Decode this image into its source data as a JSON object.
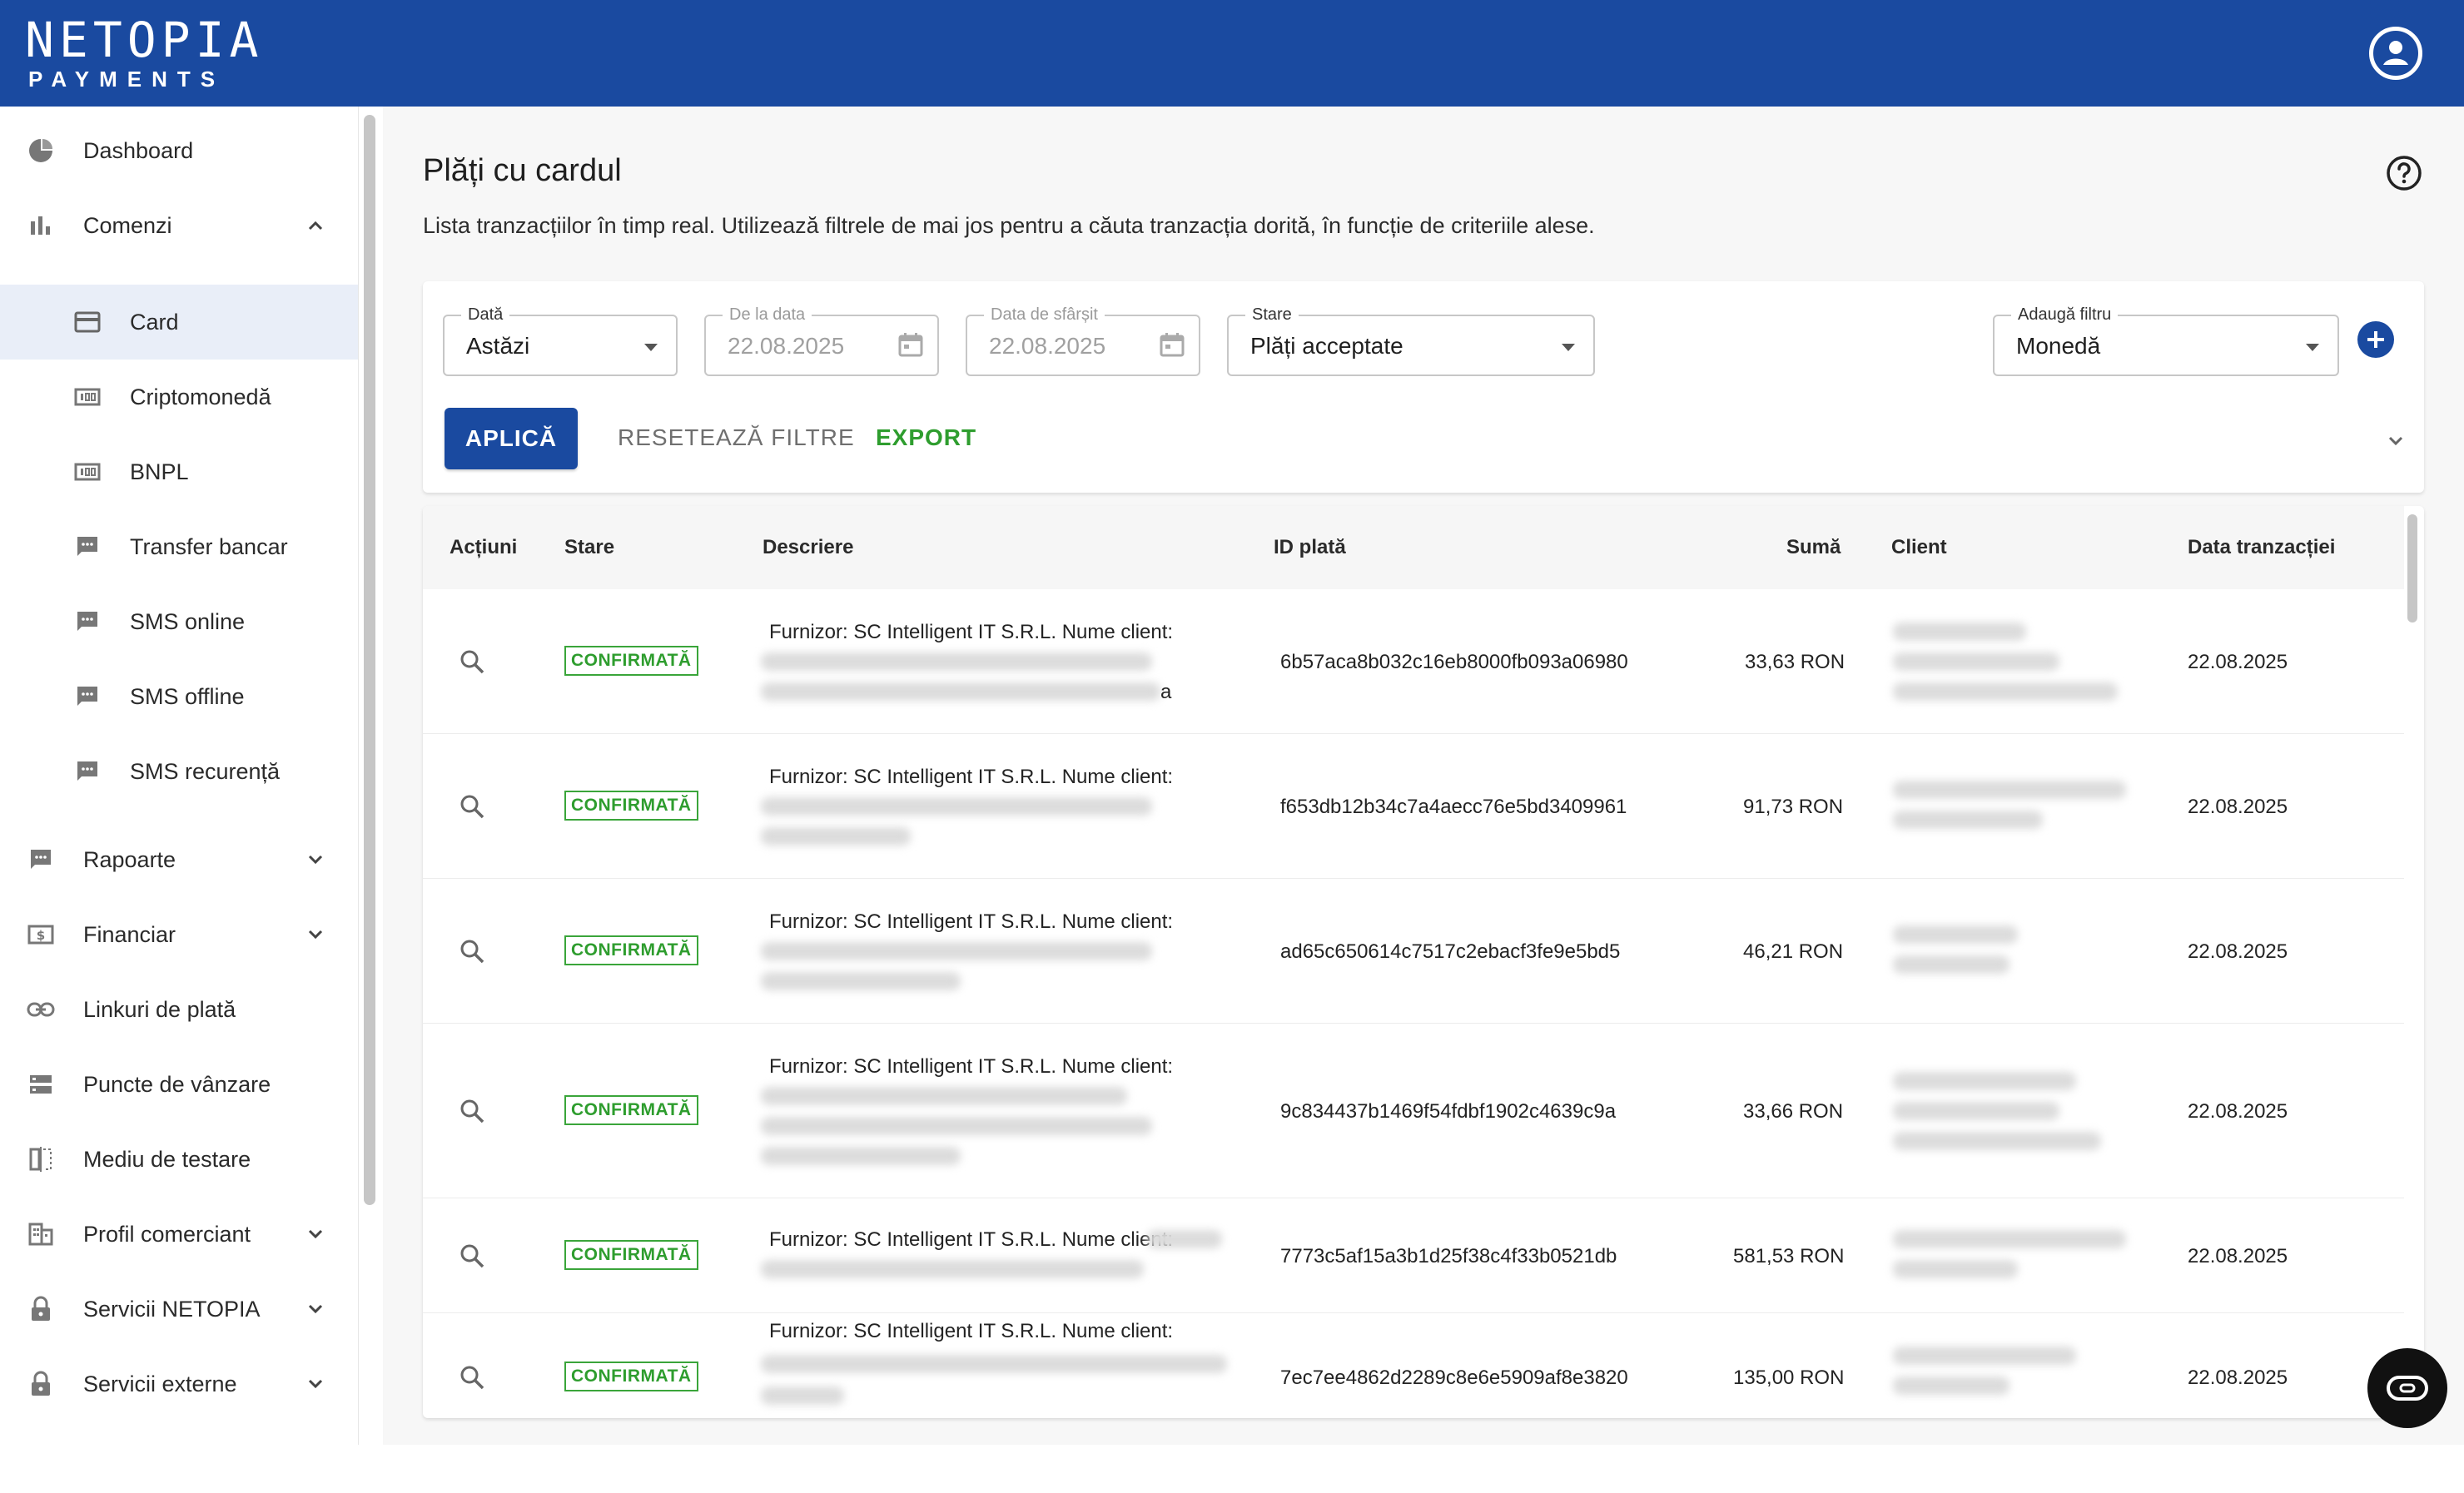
{
  "header": {
    "logo_main": "NETOPIA",
    "logo_sub": "PAYMENTS",
    "brand_color": "#1a4aa0",
    "account_icon": "account-circle-icon"
  },
  "sidebar": {
    "items": [
      {
        "label": "Dashboard",
        "icon": "pie-chart-icon"
      },
      {
        "label": "Comenzi",
        "icon": "bar-chart-icon",
        "expanded": true
      },
      {
        "label": "Card",
        "icon": "credit-card-icon",
        "active": true
      },
      {
        "label": "Criptomonedă",
        "icon": "money-icon"
      },
      {
        "label": "BNPL",
        "icon": "money-icon"
      },
      {
        "label": "Transfer bancar",
        "icon": "chat-icon"
      },
      {
        "label": "SMS online",
        "icon": "chat-icon"
      },
      {
        "label": "SMS offline",
        "icon": "chat-icon"
      },
      {
        "label": "SMS recurență",
        "icon": "chat-icon"
      },
      {
        "label": "Rapoarte",
        "icon": "chat-icon"
      },
      {
        "label": "Financiar",
        "icon": "dollar-icon"
      },
      {
        "label": "Linkuri de plată",
        "icon": "link-icon"
      },
      {
        "label": "Puncte de vânzare",
        "icon": "storage-icon"
      },
      {
        "label": "Mediu de testare",
        "icon": "compare-icon"
      },
      {
        "label": "Profil comerciant",
        "icon": "building-icon"
      },
      {
        "label": "Servicii NETOPIA",
        "icon": "lock-icon"
      },
      {
        "label": "Servicii externe",
        "icon": "lock-icon"
      }
    ]
  },
  "page": {
    "title": "Plăți cu cardul",
    "description": "Lista tranzacțiilor în timp real. Utilizează filtrele de mai jos pentru a căuta tranzacția dorită, în funcție de criteriile alese."
  },
  "filters": {
    "date": {
      "label": "Dată",
      "value": "Astăzi"
    },
    "from": {
      "label": "De la data",
      "value": "22.08.2025"
    },
    "to": {
      "label": "Data de sfârșit",
      "value": "22.08.2025"
    },
    "status": {
      "label": "Stare",
      "value": "Plăți acceptate"
    },
    "add_filter": {
      "label": "Adaugă filtru",
      "value": "Monedă"
    },
    "apply": "APLICĂ",
    "reset": "RESETEAZĂ FILTRE",
    "export": "EXPORT"
  },
  "table": {
    "columns": [
      "Acțiuni",
      "Stare",
      "Descriere",
      "ID plată",
      "Sumă",
      "Client",
      "Data tranzacției"
    ],
    "rows": [
      {
        "status": "CONFIRMATĂ",
        "desc": "Furnizor: SC Intelligent IT S.R.L. Nume client:",
        "desc_tail": "a",
        "id": "6b57aca8b032c16eb8000fb093a06980",
        "amount": "33,63 RON",
        "date": "22.08.2025"
      },
      {
        "status": "CONFIRMATĂ",
        "desc": "Furnizor: SC Intelligent IT S.R.L. Nume client:",
        "desc_tail": "",
        "id": "f653db12b34c7a4aecc76e5bd3409961",
        "amount": "91,73 RON",
        "date": "22.08.2025"
      },
      {
        "status": "CONFIRMATĂ",
        "desc": "Furnizor: SC Intelligent IT S.R.L. Nume client:",
        "desc_tail": "",
        "id": "ad65c650614c7517c2ebacf3fe9e5bd5",
        "amount": "46,21 RON",
        "date": "22.08.2025"
      },
      {
        "status": "CONFIRMATĂ",
        "desc": "Furnizor: SC Intelligent IT S.R.L. Nume client:",
        "desc_tail": "",
        "id": "9c834437b1469f54fdbf1902c4639c9a",
        "amount": "33,66 RON",
        "date": "22.08.2025"
      },
      {
        "status": "CONFIRMATĂ",
        "desc": "Furnizor: SC Intelligent IT S.R.L. Nume client:",
        "desc_tail": "",
        "id": "7773c5af15a3b1d25f38c4f33b0521db",
        "amount": "581,53 RON",
        "date": "22.08.2025"
      },
      {
        "status": "CONFIRMATĂ",
        "desc": "Furnizor: SC Intelligent IT S.R.L. Nume client:",
        "desc_tail": "",
        "id": "7ec7ee4862d2289c8e6e5909af8e3820",
        "amount": "135,00 RON",
        "date": "22.08.2025"
      }
    ]
  },
  "colors": {
    "confirmed": "#2e9d2e",
    "primary": "#1a4aa0"
  }
}
